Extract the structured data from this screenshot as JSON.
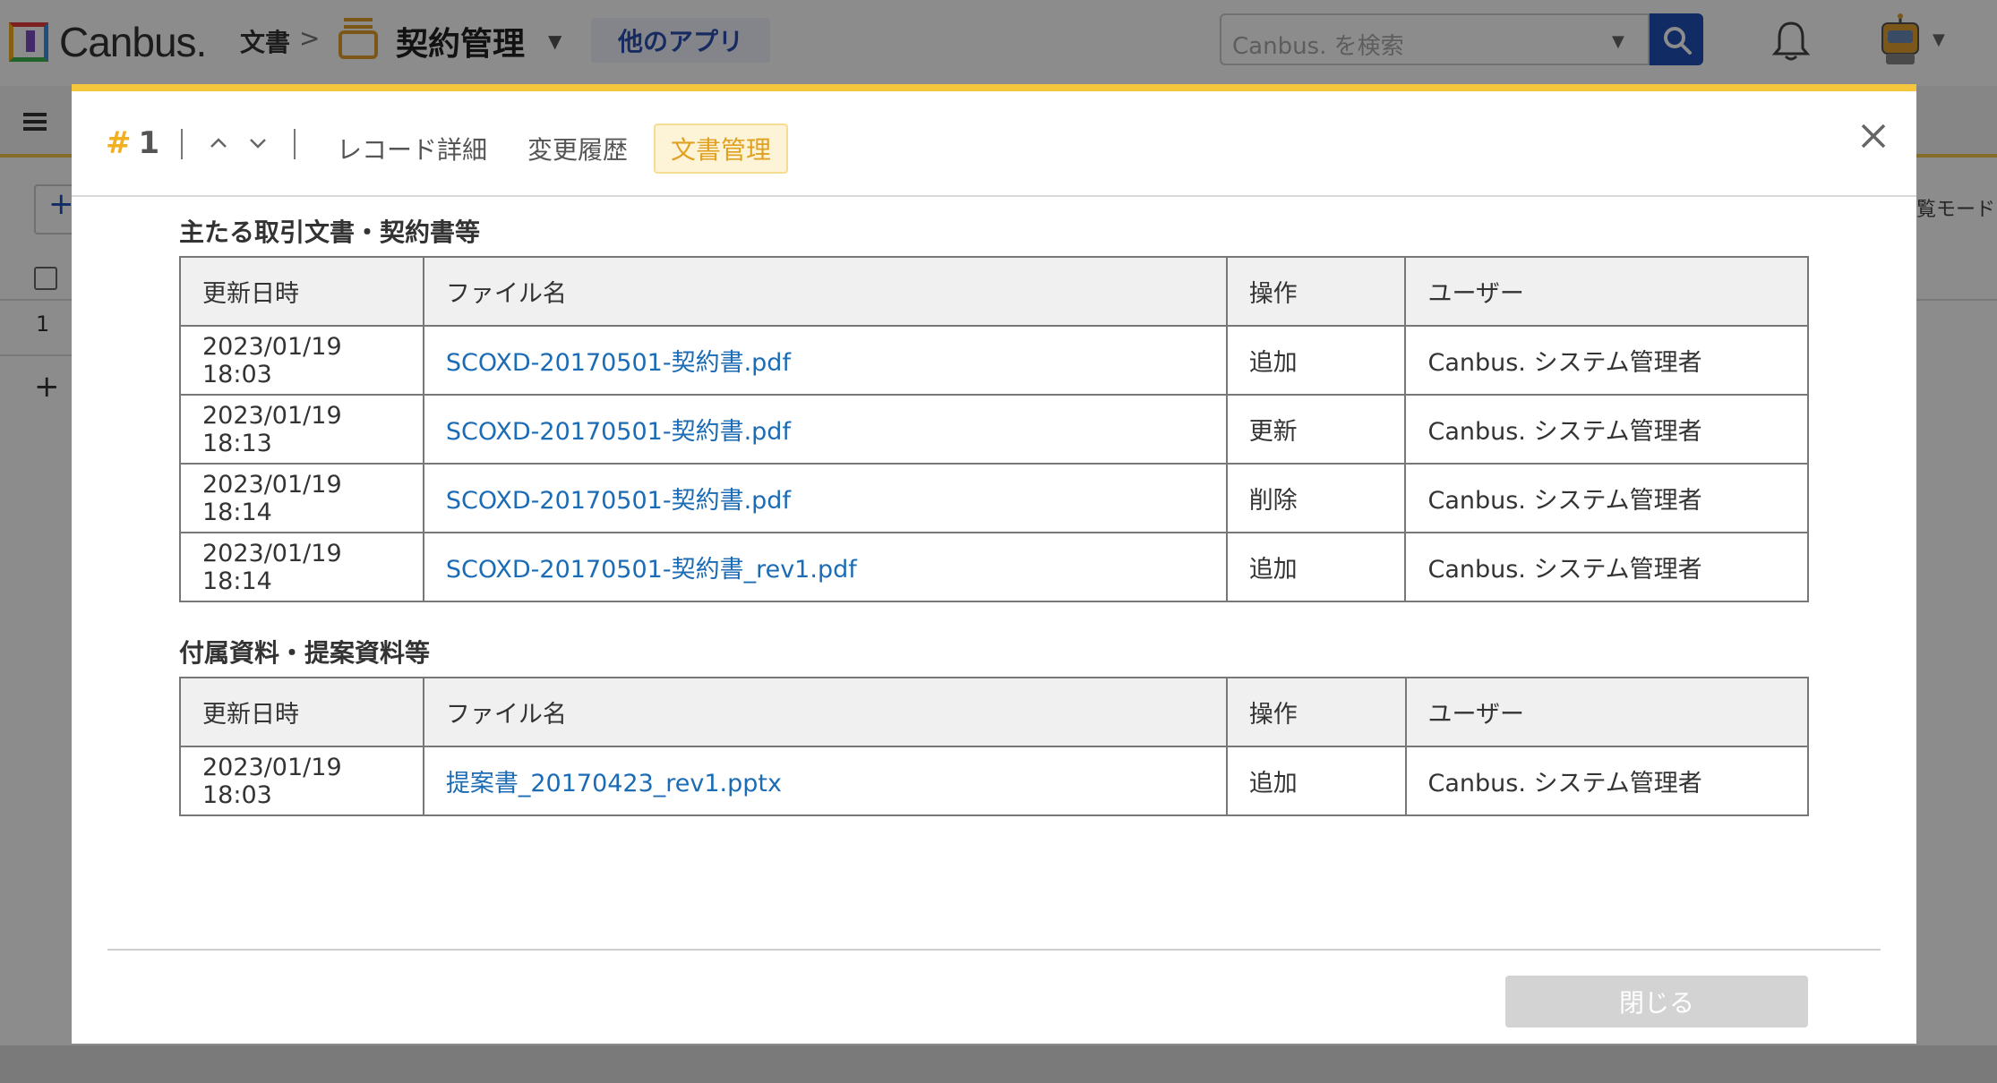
{
  "header": {
    "logo_text": "Canbus.",
    "breadcrumb": "文書",
    "app_name": "契約管理",
    "other_apps": "他のアプリ",
    "search_placeholder": "Canbus. を検索"
  },
  "background": {
    "row_number": "1",
    "view_mode_label": "覧モード"
  },
  "modal": {
    "record_hash": "#",
    "record_number": "1",
    "tabs": [
      {
        "label": "レコード詳細",
        "active": false
      },
      {
        "label": "変更履歴",
        "active": false
      },
      {
        "label": "文書管理",
        "active": true
      }
    ],
    "columns": {
      "datetime": "更新日時",
      "filename": "ファイル名",
      "operation": "操作",
      "user": "ユーザー"
    },
    "sections": [
      {
        "title": "主たる取引文書・契約書等",
        "rows": [
          {
            "datetime": "2023/01/19 18:03",
            "filename": "SCOXD-20170501-契約書.pdf",
            "operation": "追加",
            "user": "Canbus. システム管理者"
          },
          {
            "datetime": "2023/01/19 18:13",
            "filename": "SCOXD-20170501-契約書.pdf",
            "operation": "更新",
            "user": "Canbus. システム管理者"
          },
          {
            "datetime": "2023/01/19 18:14",
            "filename": "SCOXD-20170501-契約書.pdf",
            "operation": "削除",
            "user": "Canbus. システム管理者"
          },
          {
            "datetime": "2023/01/19 18:14",
            "filename": "SCOXD-20170501-契約書_rev1.pdf",
            "operation": "追加",
            "user": "Canbus. システム管理者"
          }
        ]
      },
      {
        "title": "付属資料・提案資料等",
        "rows": [
          {
            "datetime": "2023/01/19 18:03",
            "filename": "提案書_20170423_rev1.pptx",
            "operation": "追加",
            "user": "Canbus. システム管理者"
          }
        ]
      }
    ],
    "close_button": "閉じる"
  },
  "colors": {
    "accent_yellow": "#f5c53c",
    "link_blue": "#1b6bb5",
    "search_button": "#1f4fb8"
  }
}
